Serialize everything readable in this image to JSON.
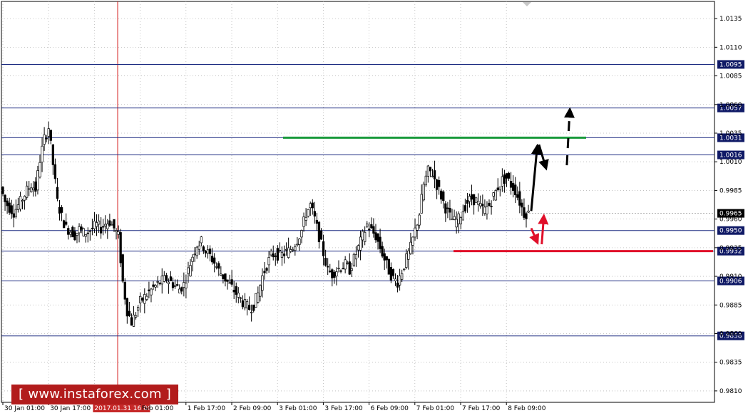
{
  "chart_data": {
    "type": "candlestick",
    "title": "",
    "ylim": [
      0.98,
      1.015
    ],
    "y_ticks": [
      "1.0135",
      "1.0110",
      "1.0085",
      "1.0060",
      "1.0035",
      "1.0010",
      "0.9985",
      "0.9960",
      "0.9935",
      "0.9910",
      "0.9885",
      "0.9860",
      "0.9835",
      "0.9810"
    ],
    "x_ticks": [
      "30 Jan 01:00",
      "30 Jan 17:00",
      "2017.01.31 16:00",
      "Feb 01:00",
      "1 Feb 17:00",
      "2 Feb 09:00",
      "3 Feb 01:00",
      "3 Feb 17:00",
      "6 Feb 09:00",
      "7 Feb 01:00",
      "7 Feb 17:00",
      "8 Feb 09:00"
    ],
    "highlighted_x_label": "2017.01.31 16:00",
    "levels": [
      {
        "label": "1.0095",
        "value": 1.0095
      },
      {
        "label": "1.0057",
        "value": 1.0057
      },
      {
        "label": "1.0031",
        "value": 1.0031
      },
      {
        "label": "1.0016",
        "value": 1.0016
      },
      {
        "label": "0.9950",
        "value": 0.995
      },
      {
        "label": "0.9932",
        "value": 0.9932
      },
      {
        "label": "0.9906",
        "value": 0.9906
      },
      {
        "label": "0.9858",
        "value": 0.9858
      }
    ],
    "current_price": {
      "label": "0.9965",
      "value": 0.9965
    },
    "resistance_line": {
      "value": 1.0031,
      "color": "#1a9a3c"
    },
    "support_line": {
      "value": 0.9932,
      "color": "#e0102a"
    },
    "price_path": [
      0.9988,
      0.9975,
      0.997,
      0.9966,
      0.9972,
      0.9978,
      0.9985,
      0.999,
      0.9986,
      1.0012,
      1.003,
      1.004,
      1.0008,
      0.9975,
      0.9962,
      0.9952,
      0.995,
      0.9946,
      0.9951,
      0.9948,
      0.9949,
      0.9952,
      0.9955,
      0.9952,
      0.9956,
      0.9958,
      0.9952,
      0.9945,
      0.9905,
      0.988,
      0.987,
      0.9878,
      0.9888,
      0.9892,
      0.9896,
      0.99,
      0.9903,
      0.9906,
      0.9908,
      0.9905,
      0.9902,
      0.9899,
      0.9903,
      0.9915,
      0.9928,
      0.9938,
      0.994,
      0.9932,
      0.9928,
      0.9922,
      0.9915,
      0.991,
      0.9905,
      0.99,
      0.9895,
      0.989,
      0.9885,
      0.9882,
      0.9885,
      0.9895,
      0.991,
      0.992,
      0.9928,
      0.993,
      0.9928,
      0.993,
      0.9932,
      0.9936,
      0.9942,
      0.995,
      0.9965,
      0.9972,
      0.996,
      0.9945,
      0.993,
      0.9915,
      0.9912,
      0.9916,
      0.9918,
      0.992,
      0.9916,
      0.9925,
      0.9935,
      0.9945,
      0.9955,
      0.995,
      0.9945,
      0.9935,
      0.9925,
      0.9915,
      0.9908,
      0.9905,
      0.9915,
      0.9925,
      0.9935,
      0.995,
      0.9965,
      0.999,
      1.0002,
      1.0,
      0.999,
      0.998,
      0.997,
      0.9962,
      0.9958,
      0.996,
      0.9968,
      0.9975,
      0.9978,
      0.9976,
      0.997,
      0.9968,
      0.9972,
      0.998,
      0.9988,
      0.9994,
      0.9996,
      0.999,
      0.9985,
      0.9975,
      0.9965
    ],
    "forecast_arrows": [
      {
        "color": "#000000",
        "style": "solid",
        "from": [
          0.9966,
          0.9967
        ],
        "to": [
          0.9992,
          1.0023
        ]
      },
      {
        "color": "#000000",
        "style": "solid",
        "from": [
          1.0,
          1.0025
        ],
        "to": [
          1.003,
          1.0005
        ]
      },
      {
        "color": "#000000",
        "style": "dashed",
        "from": [
          1.0122,
          1.0007
        ],
        "to": [
          1.0135,
          1.0055
        ]
      },
      {
        "color": "#e0102a",
        "style": "solid",
        "from": [
          0.9966,
          0.9952
        ],
        "to": [
          0.9992,
          0.994
        ]
      },
      {
        "color": "#e0102a",
        "style": "solid",
        "from": [
          1.0012,
          0.9938
        ],
        "to": [
          1.0021,
          0.9962
        ]
      }
    ],
    "grid": "dotted"
  },
  "watermark": "[ www.instaforex.com ]"
}
